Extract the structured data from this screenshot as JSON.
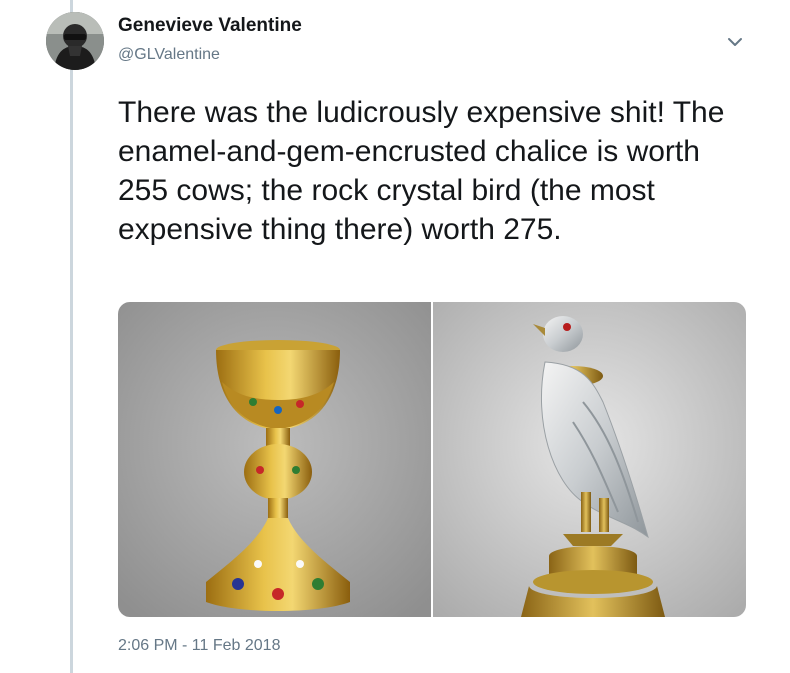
{
  "tweet": {
    "author": {
      "display_name": "Genevieve Valentine",
      "handle": "@GLValentine"
    },
    "text": "There was the ludicrously expensive shit! The enamel-and-gem-encrusted chalice is worth 255 cows; the rock crystal bird (the most expensive thing there) worth 275.",
    "timestamp": "2:06 PM - 11 Feb 2018",
    "media": [
      {
        "subject": "gold enamel-and-gem-encrusted chalice"
      },
      {
        "subject": "rock crystal bird on gilded base"
      }
    ]
  },
  "colors": {
    "text": "#14171a",
    "secondary": "#657786",
    "thread_line": "#ccd6dd"
  },
  "icons": {
    "caret": "chevron-down-icon"
  }
}
